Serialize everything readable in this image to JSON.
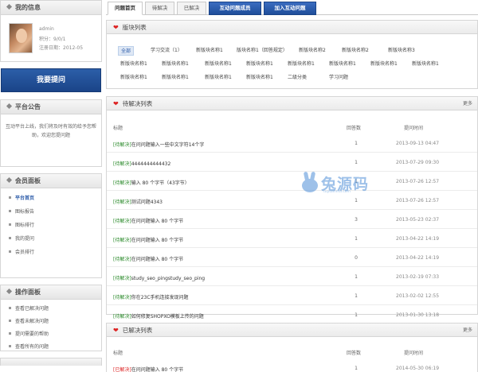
{
  "sidebar": {
    "my_info_title": "我的信息",
    "user": {
      "name_line": "admin",
      "level_line": "积分：9/0/1",
      "register_line": "注册日期：2012-05"
    },
    "ask_button": "我要提问",
    "notice_title": "平台公告",
    "notice_text": "互动平台上线，我们将及时有效的给予您帮助，欢迎您提问题",
    "member_title": "会员面板",
    "member_items": [
      "平台首页",
      "图标报告",
      "图标排行",
      "我的提问",
      "会员排行"
    ],
    "op_title": "操作面板",
    "op_items": [
      "查看已解决问题",
      "查看未解决问题",
      "提问需要的帮助",
      "查看所有的问题"
    ]
  },
  "tabs": [
    "问题首页",
    "待解决",
    "已解决",
    "互动问题成员",
    "加入互动问题"
  ],
  "sections": {
    "title": "版块列表",
    "items": [
      "全部",
      "学习交流（1）",
      "新版块名称1",
      "版块名称1（回答规定）",
      "新版块名称2",
      "新版块名称2",
      "新版块名称3",
      "新版块名称1",
      "新版块名称1",
      "新版块名称1",
      "新版块名称1",
      "新版块名称1",
      "新版块名称1",
      "新版块名称1",
      "新版块名称1",
      "新版块名称1",
      "新版块名称1",
      "新版块名称1",
      "新版块名称1",
      "二级分类",
      "学习问题"
    ]
  },
  "pending": {
    "title": "待解决列表",
    "more": "更多",
    "headers": {
      "title": "标题",
      "count": "回答数",
      "time": "提问时间"
    },
    "rows": [
      {
        "tag": "[待解决]",
        "title": "在问问题输入一些中文字符14个字",
        "count": "1",
        "time": "2013-09-13 04:47"
      },
      {
        "tag": "[待解决]",
        "title": "4444444444432",
        "count": "1",
        "time": "2013-07-29 09:30"
      },
      {
        "tag": "[待解决]",
        "title": "输入 80 个字节（43字节）",
        "count": "1",
        "time": "2013-07-26 12:57"
      },
      {
        "tag": "[待解决]",
        "title": "测试问题4343",
        "count": "1",
        "time": "2013-07-26 12:57"
      },
      {
        "tag": "[待解决]",
        "title": "在问问题输入 80 个字节",
        "count": "3",
        "time": "2013-05-23 02:37"
      },
      {
        "tag": "[待解决]",
        "title": "在问问题输入 80 个字节",
        "count": "1",
        "time": "2013-04-22 14:19"
      },
      {
        "tag": "[待解决]",
        "title": "在问问题输入 80 个字节",
        "count": "0",
        "time": "2013-04-22 14:19"
      },
      {
        "tag": "[待解决]",
        "title": "study_seo_pingstudy_seo_ping",
        "count": "1",
        "time": "2013-02-19 07:33"
      },
      {
        "tag": "[待解决]",
        "title": "你在23C手机连接发现问题",
        "count": "1",
        "time": "2013-02-02 12:55"
      },
      {
        "tag": "[待解决]",
        "title": "如何修复SHOPXO模板上传的问题",
        "count": "1",
        "time": "2013-01-30 13:18"
      }
    ]
  },
  "resolved": {
    "title": "已解决列表",
    "more": "更多",
    "headers": {
      "title": "标题",
      "count": "回答数",
      "time": "提问时间"
    },
    "rows": [
      {
        "tag": "[已解决]",
        "title": "在问问题输入 80 个字节",
        "count": "1",
        "time": "2014-05-30 06:19"
      }
    ]
  },
  "watermark": {
    "text": "兔源码",
    "url": "tuyuanma.com"
  },
  "colors": {
    "accent_blue": "#1f4e9a",
    "heart_red": "#dd2222",
    "tag_green": "#2a8a2a"
  }
}
